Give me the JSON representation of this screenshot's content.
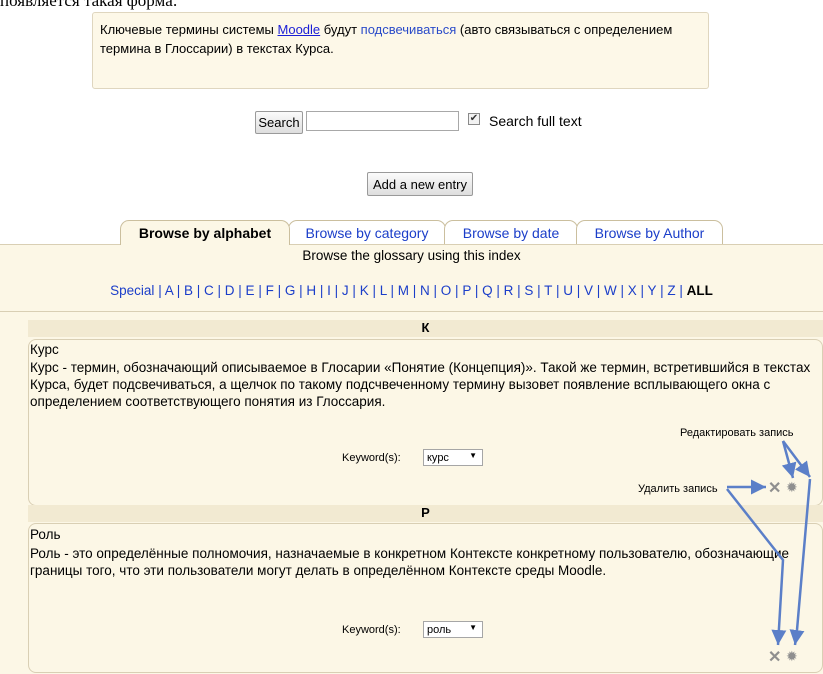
{
  "page_caption": "появляется такая форма:",
  "intro": {
    "part1": "Ключевые термины системы ",
    "link": "Moodle",
    "part2": " будут ",
    "highlight": "подсвечиваться",
    "part3": " (авто связываться с определением термина в Глоссарии) в текстах Курса."
  },
  "search": {
    "button_label": "Search",
    "input_value": "",
    "fulltext_checked": true,
    "fulltext_label": "Search full text"
  },
  "add_entry_label": "Add a new entry",
  "tabs": [
    {
      "label": "Browse by alphabet",
      "active": true
    },
    {
      "label": "Browse by category",
      "active": false
    },
    {
      "label": "Browse by date",
      "active": false
    },
    {
      "label": "Browse by Author",
      "active": false
    }
  ],
  "browse_caption": "Browse the glossary using this index",
  "alphabet": [
    "Special",
    "A",
    "B",
    "C",
    "D",
    "E",
    "F",
    "G",
    "H",
    "I",
    "J",
    "K",
    "L",
    "M",
    "N",
    "O",
    "P",
    "Q",
    "R",
    "S",
    "T",
    "U",
    "V",
    "W",
    "X",
    "Y",
    "Z"
  ],
  "alphabet_all": "ALL",
  "entries": [
    {
      "letter": "К",
      "title": "Курс",
      "definition": "Курс - термин, обозначающий описываемое в Глосарии «Понятие (Концепция)». Такой же термин, встретившийся в текстах Курса, будет подсвечиваться, а щелчок по такому подсчвеченному термину вызовет появление всплывающего окна с определением соответствующего понятия из Глоссария.",
      "keyword_label": "Keyword(s):",
      "keyword": "курс"
    },
    {
      "letter": "Р",
      "title": "Роль",
      "definition": "Роль - это определённые полномочия, назначаемые в конкретном Контексте конкретному пользователю, обозначающие границы того, что эти пользователи могут делать в определённом Контексте среды Moodle.",
      "keyword_label": "Keyword(s):",
      "keyword": "роль"
    }
  ],
  "annotations": {
    "edit": "Редактировать запись",
    "delete": "Удалить запись"
  },
  "icons": {
    "delete": "close-icon",
    "edit": "gear-icon"
  },
  "colors": {
    "accent_link": "#1b3ec9",
    "panel_bg": "#fcf7e6",
    "arrow": "#5b7fc8"
  }
}
